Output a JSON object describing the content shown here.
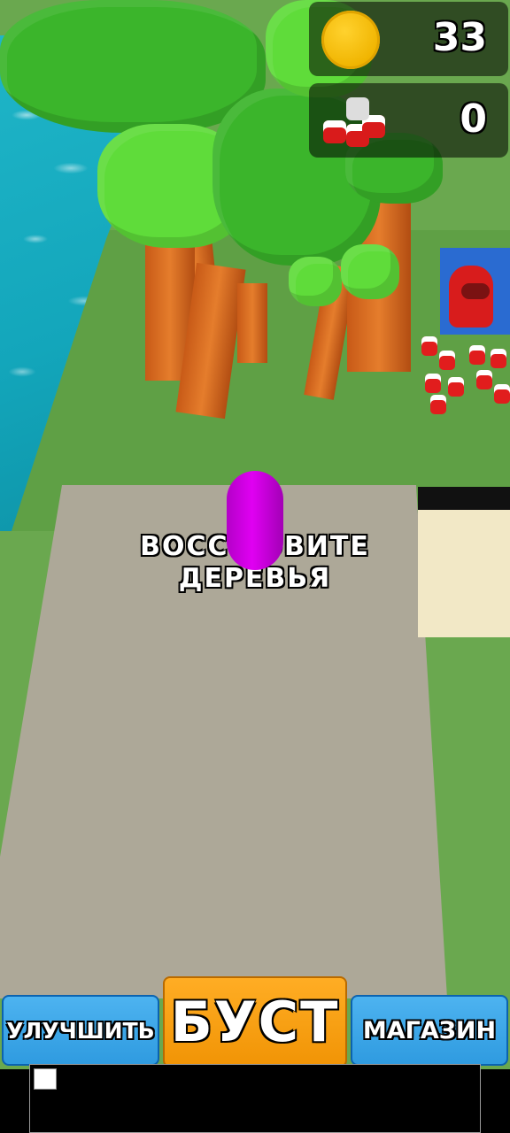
{
  "hud": {
    "coins": "33",
    "crowd_count": "0"
  },
  "caption": {
    "line1": "ВОССТ ОВИТЕ",
    "line2": "ДЕРЕВЬЯ"
  },
  "buttons": {
    "upgrade": "УЛУЧШИТЬ",
    "boost": "БУСТ",
    "shop": "МАГАЗИН"
  },
  "icons": {
    "coin": "coin-icon",
    "crowd": "crowd-icon"
  },
  "colors": {
    "boost_button": "#f19405",
    "side_buttons": "#2f9be0",
    "player": "#e000f2",
    "coin": "#f0b400"
  }
}
